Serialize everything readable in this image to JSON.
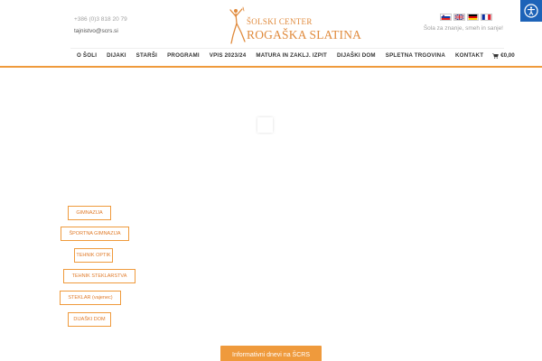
{
  "contact": {
    "phone": "+386 (0)3 818 20 79",
    "email": "tajnistvo@scrs.si"
  },
  "logo": {
    "line1": "ŠOLSKI CENTER",
    "line2": "ROGAŠKA SLATINA"
  },
  "flags": [
    {
      "name": "slovenian-flag-icon"
    },
    {
      "name": "english-flag-icon"
    },
    {
      "name": "german-flag-icon"
    },
    {
      "name": "french-flag-icon"
    }
  ],
  "tagline": "Šola za znanje, smeh in sanje!",
  "nav": {
    "items": [
      "O ŠOLI",
      "DIJAKI",
      "STARŠI",
      "PROGRAMI",
      "VPIS 2023/24",
      "MATURA IN ZAKLJ. IZPIT",
      "DIJAŠKI DOM",
      "SPLETNA TRGOVINA",
      "KONTAKT"
    ],
    "cart_total": "€0,00"
  },
  "schools": [
    "GIMNAZIJA",
    "ŠPORTNA GIMNAZIJA",
    "TEHNIK OPTIK",
    "TEHNIK STEKLARSTVA",
    "STEKLAR (vajenec)",
    "DIJAŠKI DOM"
  ],
  "info_button": "Informativni dnevi na ŠCRS",
  "colors": {
    "accent": "#ef9a3c",
    "accessibility": "#1d63b8",
    "nav_text": "#333333"
  }
}
